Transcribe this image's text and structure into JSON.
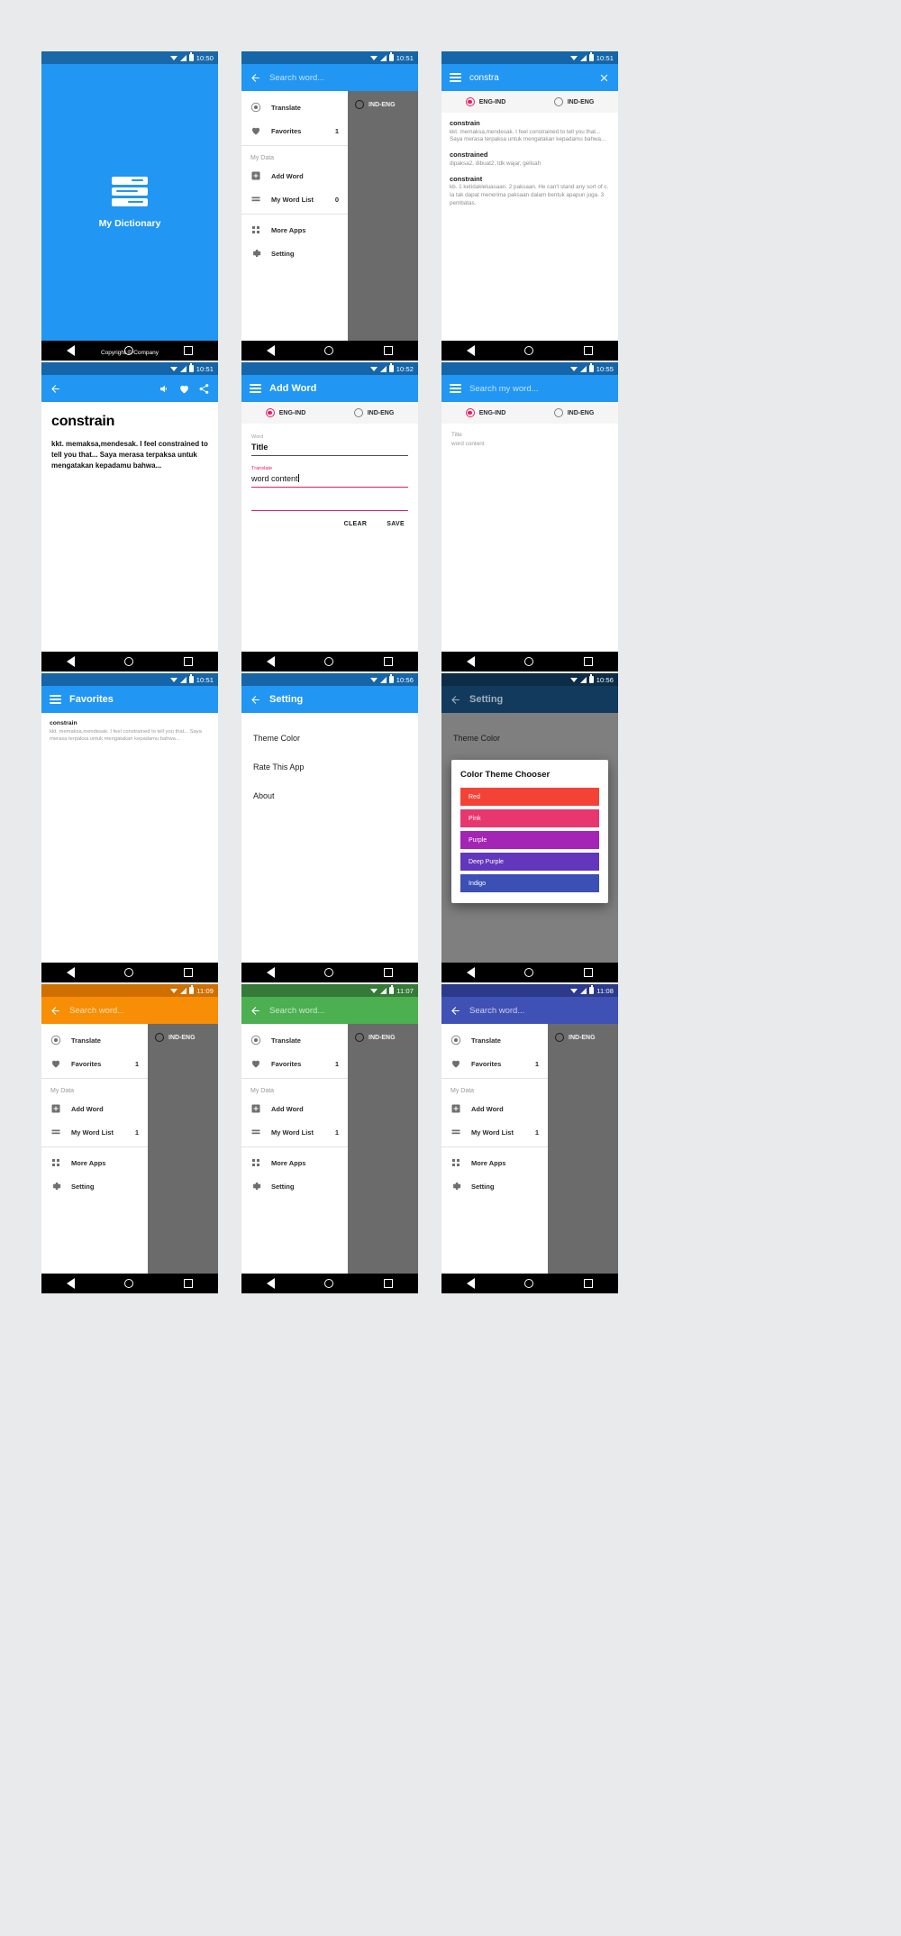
{
  "app": {
    "name": "My Dictionary",
    "copyright": "Copyright © Company"
  },
  "colors": {
    "blue": "#2196f3",
    "blue_dark": "#1565a8",
    "blue_status": "#1a68a8",
    "pink_accent": "#e91e63",
    "orange": "#f78e05",
    "orange_dark": "#cf6f00",
    "green": "#4caf50",
    "green_dark": "#357a38",
    "indigo": "#3f51b5",
    "indigo_dark": "#2c3a8c",
    "navy_dark": "#123a5c"
  },
  "screens": [
    {
      "id": "splash",
      "time": "10:50",
      "title": "My Dictionary",
      "copyright": "Copyright © Company"
    },
    {
      "id": "drawer-open",
      "time": "10:51",
      "search_placeholder": "Search word...",
      "drawer": {
        "items": [
          {
            "label": "Translate",
            "icon": "translate-icon",
            "count": ""
          },
          {
            "label": "Favorites",
            "icon": "heart-icon",
            "count": "1"
          }
        ],
        "section_label": "My Data",
        "data_items": [
          {
            "label": "Add Word",
            "icon": "plus-box-icon",
            "count": ""
          },
          {
            "label": "My Word List",
            "icon": "list-icon",
            "count": "0"
          }
        ],
        "footer_items": [
          {
            "label": "More Apps",
            "icon": "apps-grid-icon"
          },
          {
            "label": "Setting",
            "icon": "gear-icon"
          }
        ]
      },
      "scrim_radio": "IND-ENG"
    },
    {
      "id": "search-results",
      "time": "10:51",
      "query": "constra",
      "radios": [
        {
          "label": "ENG-IND",
          "selected": true
        },
        {
          "label": "IND-ENG",
          "selected": false
        }
      ],
      "results": [
        {
          "word": "constrain",
          "definition": "kkt. memaksa,mendesak.   I feel constrained to tell you that... Saya merasa terpaksa untuk mengatakan kepadamu bahwa..."
        },
        {
          "word": "constrained",
          "definition": "dipaksa2, dibuat2, tdk wajar, gelisah"
        },
        {
          "word": "constraint",
          "definition": "kb. 1 ketidakleluasaan. 2 paksaan. He can't stand any sort of c.  Ia tak dapat menerima paksaan dalam bentuk apapun juga. 3 pembatas."
        }
      ]
    },
    {
      "id": "word-detail",
      "time": "10:51",
      "word": "constrain",
      "definition": "kkt. memaksa,mendesak.   I feel constrained to tell you that... Saya merasa terpaksa untuk mengatakan kepadamu bahwa...",
      "actions": [
        "speaker-icon",
        "heart-icon",
        "share-icon"
      ]
    },
    {
      "id": "add-word",
      "time": "10:52",
      "title": "Add Word",
      "radios": [
        {
          "label": "ENG-IND",
          "selected": true
        },
        {
          "label": "IND-ENG",
          "selected": false
        }
      ],
      "fields": [
        {
          "label": "Word",
          "value": "Title"
        },
        {
          "label": "Translate",
          "value": "word content"
        }
      ],
      "buttons": {
        "clear": "CLEAR",
        "save": "SAVE"
      }
    },
    {
      "id": "my-word-list",
      "time": "10:55",
      "search_placeholder": "Search my word...",
      "radios": [
        {
          "label": "ENG-IND",
          "selected": true
        },
        {
          "label": "IND-ENG",
          "selected": false
        }
      ],
      "entry": {
        "title": "Title",
        "content": "word content"
      }
    },
    {
      "id": "favorites",
      "time": "10:51",
      "title": "Favorites",
      "entry": {
        "word": "constrain",
        "definition": "kkt. memaksa,mendesak.  I feel constrained to tell you that... Saya merasa terpaksa untuk mengatakan kepadamu bahwa..."
      }
    },
    {
      "id": "setting",
      "time": "10:56",
      "title": "Setting",
      "rows": [
        "Theme Color",
        "Rate This App",
        "About"
      ]
    },
    {
      "id": "color-dialog",
      "time": "10:56",
      "title": "Setting",
      "behind_row": "Theme Color",
      "dialog": {
        "title": "Color Theme Chooser",
        "options": [
          {
            "label": "Red",
            "color": "#f44336"
          },
          {
            "label": "Pink",
            "color": "#e8366f"
          },
          {
            "label": "Purple",
            "color": "#a324b5"
          },
          {
            "label": "Deep Purple",
            "color": "#6236bd"
          },
          {
            "label": "Indigo",
            "color": "#3b4fb5"
          }
        ]
      }
    },
    {
      "id": "theme-orange",
      "time": "11:09",
      "search_placeholder": "Search word...",
      "theme": "#f78e05",
      "theme_dark": "#cf6f00",
      "drawer": {
        "items": [
          {
            "label": "Translate",
            "icon": "translate-icon",
            "count": ""
          },
          {
            "label": "Favorites",
            "icon": "heart-icon",
            "count": "1"
          }
        ],
        "section_label": "My Data",
        "data_items": [
          {
            "label": "Add Word",
            "icon": "plus-box-icon",
            "count": ""
          },
          {
            "label": "My Word List",
            "icon": "list-icon",
            "count": "1"
          }
        ],
        "footer_items": [
          {
            "label": "More Apps",
            "icon": "apps-grid-icon"
          },
          {
            "label": "Setting",
            "icon": "gear-icon"
          }
        ]
      },
      "scrim_radio": "IND-ENG"
    },
    {
      "id": "theme-green",
      "time": "11:07",
      "search_placeholder": "Search word...",
      "theme": "#4caf50",
      "theme_dark": "#357a38",
      "drawer": {
        "items": [
          {
            "label": "Translate",
            "icon": "translate-icon",
            "count": ""
          },
          {
            "label": "Favorites",
            "icon": "heart-icon",
            "count": "1"
          }
        ],
        "section_label": "My Data",
        "data_items": [
          {
            "label": "Add Word",
            "icon": "plus-box-icon",
            "count": ""
          },
          {
            "label": "My Word List",
            "icon": "list-icon",
            "count": "1"
          }
        ],
        "footer_items": [
          {
            "label": "More Apps",
            "icon": "apps-grid-icon"
          },
          {
            "label": "Setting",
            "icon": "gear-icon"
          }
        ]
      },
      "scrim_radio": "IND-ENG"
    },
    {
      "id": "theme-indigo",
      "time": "11:08",
      "search_placeholder": "Search word...",
      "theme": "#3f51b5",
      "theme_dark": "#2c3a8c",
      "drawer": {
        "items": [
          {
            "label": "Translate",
            "icon": "translate-icon",
            "count": ""
          },
          {
            "label": "Favorites",
            "icon": "heart-icon",
            "count": "1"
          }
        ],
        "section_label": "My Data",
        "data_items": [
          {
            "label": "Add Word",
            "icon": "plus-box-icon",
            "count": ""
          },
          {
            "label": "My Word List",
            "icon": "list-icon",
            "count": "1"
          }
        ],
        "footer_items": [
          {
            "label": "More Apps",
            "icon": "apps-grid-icon"
          },
          {
            "label": "Setting",
            "icon": "gear-icon"
          }
        ]
      },
      "scrim_radio": "IND-ENG"
    }
  ]
}
